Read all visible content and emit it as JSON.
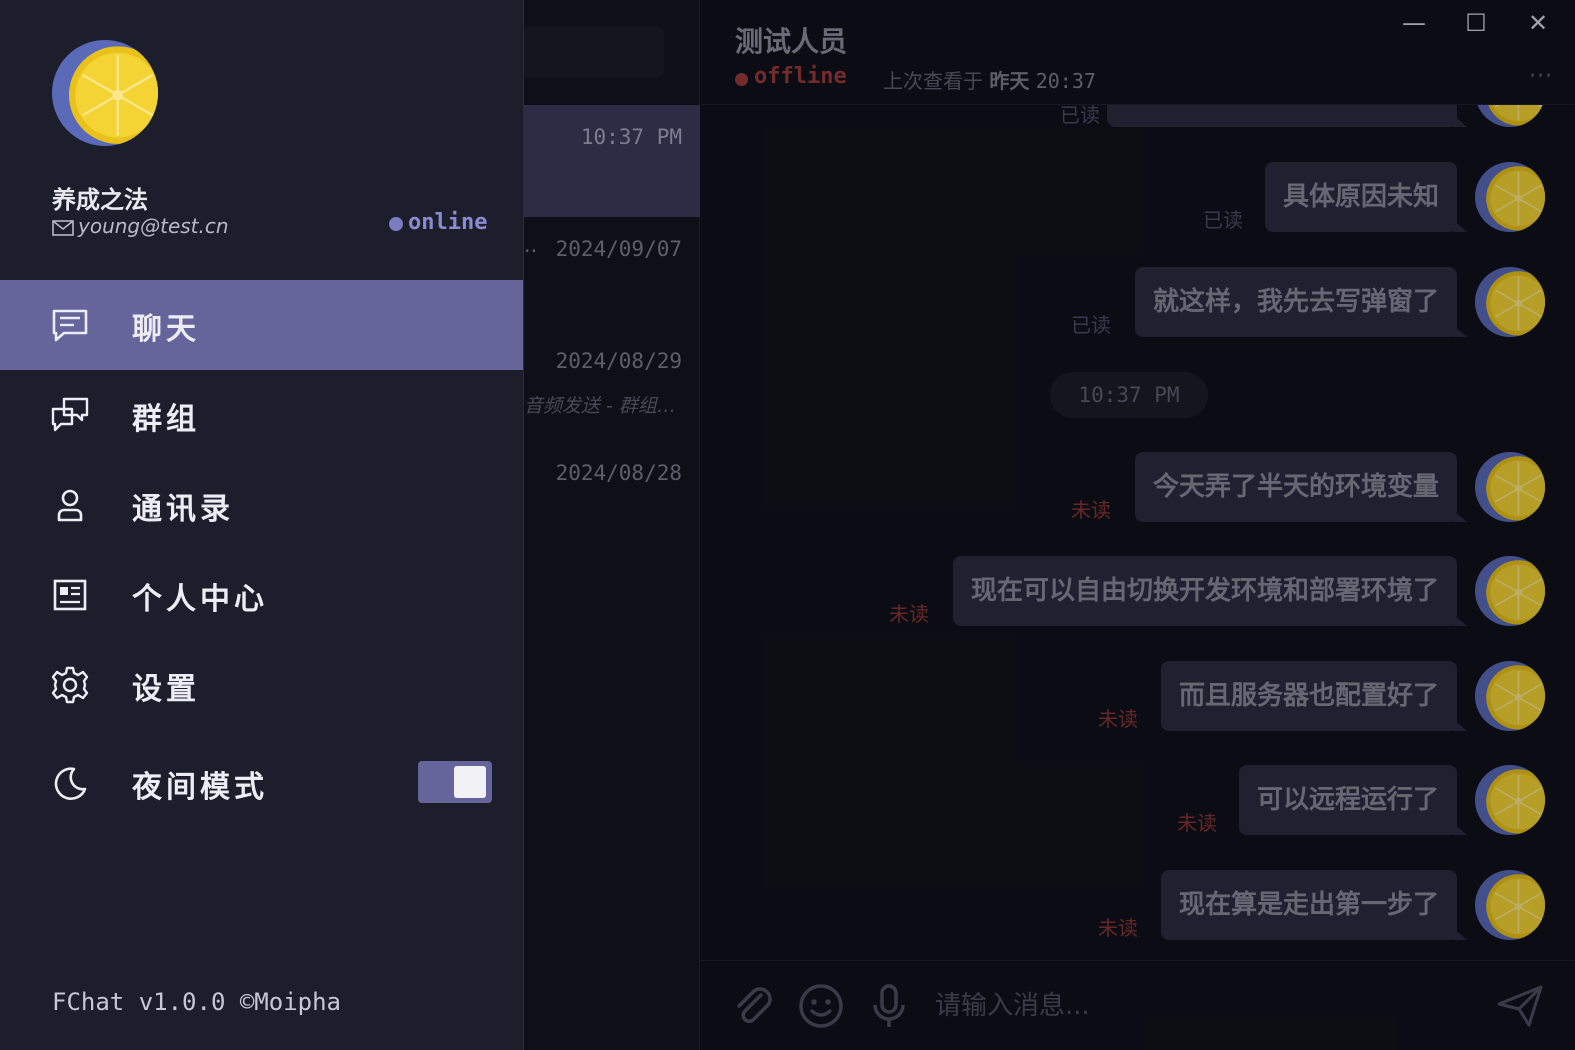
{
  "window": {
    "minimize_glyph": "—",
    "maximize_glyph": "☐",
    "close_glyph": "✕"
  },
  "conversation_list": {
    "items": [
      {
        "time": "10:37 PM",
        "preview": ""
      },
      {
        "time": "2024/09/07",
        "preview": ""
      },
      {
        "time": "2024/08/29",
        "preview": "音频发送 - 群组…"
      },
      {
        "time": "2024/08/28",
        "preview": ""
      }
    ],
    "truncation_marker": ".."
  },
  "chat": {
    "title": "测试人员",
    "status": "offline",
    "last_seen_prefix": "上次查看于",
    "last_seen_day": "昨天",
    "last_seen_time": "20:37",
    "more_glyph": "···",
    "time_divider": "10:37 PM",
    "messages": [
      {
        "text": "",
        "state": "已读"
      },
      {
        "text": "具体原因未知",
        "state": "已读"
      },
      {
        "text": "就这样，我先去写弹窗了",
        "state": "已读"
      },
      {
        "text": "今天弄了半天的环境变量",
        "state": "未读"
      },
      {
        "text": "现在可以自由切换开发环境和部署环境了",
        "state": "未读"
      },
      {
        "text": "而且服务器也配置好了",
        "state": "未读"
      },
      {
        "text": "可以远程运行了",
        "state": "未读"
      },
      {
        "text": "现在算是走出第一步了",
        "state": "未读"
      }
    ],
    "input_placeholder": "请输入消息..."
  },
  "drawer": {
    "user_name": "养成之法",
    "email": "young@test.cn",
    "status": "online",
    "nav": [
      {
        "label": "聊天",
        "icon": "chat-icon"
      },
      {
        "label": "群组",
        "icon": "group-chat-icon"
      },
      {
        "label": "通讯录",
        "icon": "contacts-icon"
      },
      {
        "label": "个人中心",
        "icon": "profile-card-icon"
      },
      {
        "label": "设置",
        "icon": "gear-icon"
      },
      {
        "label": "夜间模式",
        "icon": "moon-icon"
      }
    ],
    "night_mode_on": true,
    "footer": "FChat v1.0.0 ©Moipha"
  },
  "colors": {
    "accent": "#65659c",
    "drawer_bg": "#1d1e2c",
    "chat_bg": "#11121b",
    "unread": "#8b3535",
    "offline": "#9b3a3a"
  }
}
